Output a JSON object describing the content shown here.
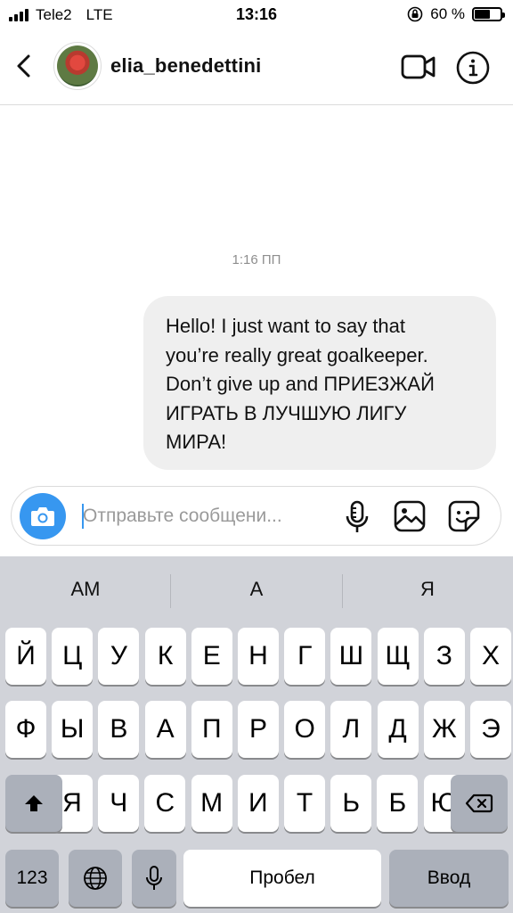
{
  "status_bar": {
    "carrier": "Tele2",
    "network": "LTE",
    "time": "13:16",
    "battery_text": "60 %",
    "battery_level": 0.6
  },
  "header": {
    "username": "elia_benedettini"
  },
  "conversation": {
    "timestamp": "1:16 ПП",
    "message": "Hello! I just want to say that\nyou’re really great goalkeeper.\nDon’t give up and ПРИЕЗЖАЙ\nИГРАТЬ В ЛУЧШУЮ ЛИГУ\nМИРА!"
  },
  "composer": {
    "placeholder": "Отправьте сообщени..."
  },
  "keyboard": {
    "suggestions": [
      "АМ",
      "А",
      "Я"
    ],
    "row1": [
      "Й",
      "Ц",
      "У",
      "К",
      "Е",
      "Н",
      "Г",
      "Ш",
      "Щ",
      "З",
      "Х"
    ],
    "row2": [
      "Ф",
      "Ы",
      "В",
      "А",
      "П",
      "Р",
      "О",
      "Л",
      "Д",
      "Ж",
      "Э"
    ],
    "row3": [
      "Я",
      "Ч",
      "С",
      "М",
      "И",
      "Т",
      "Ь",
      "Б",
      "Ю"
    ],
    "numbers_key": "123",
    "space_key": "Пробел",
    "return_key": "Ввод"
  },
  "icons": {
    "back": "chevron-left-icon",
    "video": "video-camera-icon",
    "info": "info-icon",
    "camera": "camera-icon",
    "mic": "microphone-icon",
    "gallery": "image-gallery-icon",
    "sticker": "sticker-icon",
    "shift": "shift-arrow-icon",
    "delete": "backspace-icon",
    "globe": "globe-icon"
  },
  "colors": {
    "accent": "#3797f0",
    "bubble": "#efefef",
    "keyboard_bg": "#d1d3d9",
    "key_fn": "#abb0ba"
  }
}
